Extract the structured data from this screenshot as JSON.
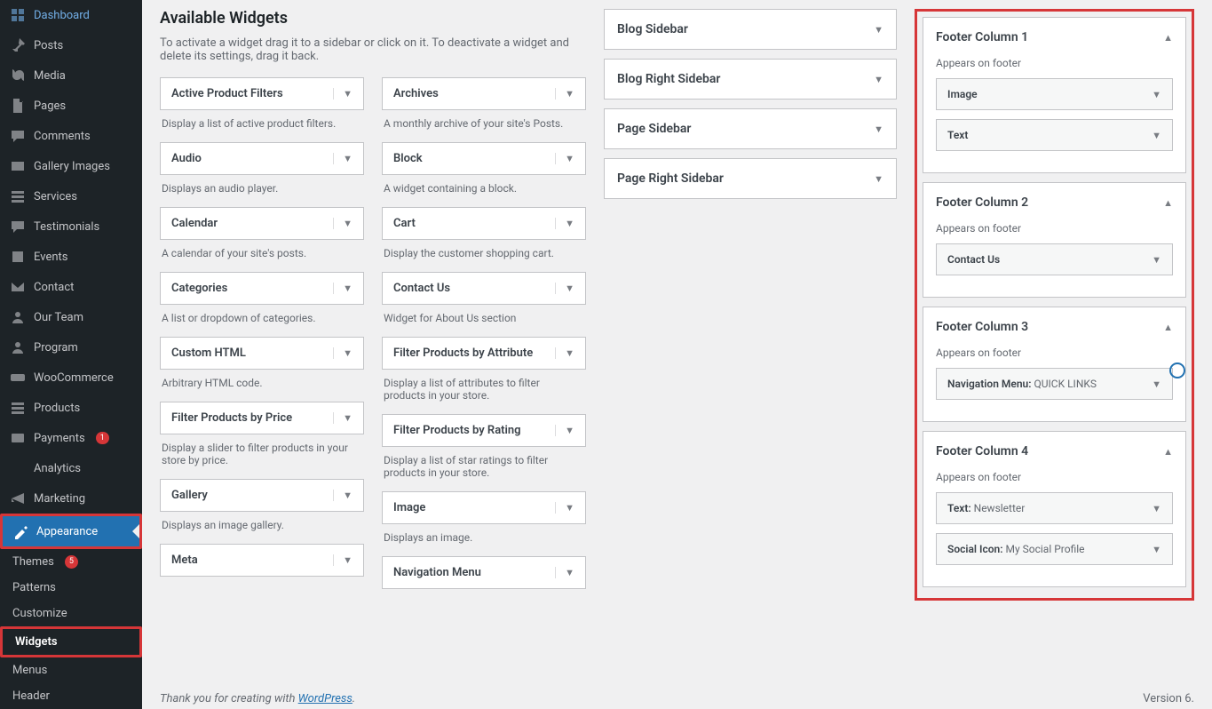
{
  "sidebar": {
    "items": [
      {
        "icon": "dashboard",
        "label": "Dashboard"
      },
      {
        "icon": "pin",
        "label": "Posts"
      },
      {
        "icon": "media",
        "label": "Media"
      },
      {
        "icon": "page",
        "label": "Pages"
      },
      {
        "icon": "comment",
        "label": "Comments"
      },
      {
        "icon": "gallery",
        "label": "Gallery Images"
      },
      {
        "icon": "services",
        "label": "Services"
      },
      {
        "icon": "testimonial",
        "label": "Testimonials"
      },
      {
        "icon": "calendar",
        "label": "Events"
      },
      {
        "icon": "mail",
        "label": "Contact"
      },
      {
        "icon": "team",
        "label": "Our Team"
      },
      {
        "icon": "program",
        "label": "Program"
      },
      {
        "icon": "woo",
        "label": "WooCommerce"
      },
      {
        "icon": "products",
        "label": "Products"
      },
      {
        "icon": "payments",
        "label": "Payments",
        "badge": "1"
      },
      {
        "icon": "analytics",
        "label": "Analytics"
      },
      {
        "icon": "marketing",
        "label": "Marketing"
      },
      {
        "icon": "appearance",
        "label": "Appearance",
        "active": true
      }
    ],
    "submenu": [
      {
        "label": "Themes",
        "badge": "5"
      },
      {
        "label": "Patterns"
      },
      {
        "label": "Customize"
      },
      {
        "label": "Widgets",
        "current": true
      },
      {
        "label": "Menus"
      },
      {
        "label": "Header"
      }
    ]
  },
  "available": {
    "title": "Available Widgets",
    "desc": "To activate a widget drag it to a sidebar or click on it. To deactivate a widget and delete its settings, drag it back.",
    "left": [
      {
        "name": "Active Product Filters",
        "desc": "Display a list of active product filters."
      },
      {
        "name": "Audio",
        "desc": "Displays an audio player."
      },
      {
        "name": "Calendar",
        "desc": "A calendar of your site's posts."
      },
      {
        "name": "Categories",
        "desc": "A list or dropdown of categories."
      },
      {
        "name": "Custom HTML",
        "desc": "Arbitrary HTML code."
      },
      {
        "name": "Filter Products by Price",
        "desc": "Display a slider to filter products in your store by price."
      },
      {
        "name": "Gallery",
        "desc": "Displays an image gallery."
      },
      {
        "name": "Meta",
        "desc": ""
      }
    ],
    "right": [
      {
        "name": "Archives",
        "desc": "A monthly archive of your site's Posts."
      },
      {
        "name": "Block",
        "desc": "A widget containing a block."
      },
      {
        "name": "Cart",
        "desc": "Display the customer shopping cart."
      },
      {
        "name": "Contact Us",
        "desc": "Widget for About Us section"
      },
      {
        "name": "Filter Products by Attribute",
        "desc": "Display a list of attributes to filter products in your store."
      },
      {
        "name": "Filter Products by Rating",
        "desc": "Display a list of star ratings to filter products in your store."
      },
      {
        "name": "Image",
        "desc": "Displays an image."
      },
      {
        "name": "Navigation Menu",
        "desc": ""
      }
    ]
  },
  "mid_areas": [
    {
      "title": "Blog Sidebar"
    },
    {
      "title": "Blog Right Sidebar"
    },
    {
      "title": "Page Sidebar"
    },
    {
      "title": "Page Right Sidebar"
    }
  ],
  "right_areas": [
    {
      "title": "Footer Column 1",
      "sub": "Appears on footer",
      "widgets": [
        {
          "label": "Image"
        },
        {
          "label": "Text"
        }
      ]
    },
    {
      "title": "Footer Column 2",
      "sub": "Appears on footer",
      "widgets": [
        {
          "label": "Contact Us"
        }
      ]
    },
    {
      "title": "Footer Column 3",
      "sub": "Appears on footer",
      "widgets": [
        {
          "label": "Navigation Menu:",
          "thin": " QUICK LINKS"
        }
      ]
    },
    {
      "title": "Footer Column 4",
      "sub": "Appears on footer",
      "widgets": [
        {
          "label": "Text:",
          "thin": " Newsletter"
        },
        {
          "label": "Social Icon:",
          "thin": " My Social Profile"
        }
      ]
    }
  ],
  "footer": {
    "credit_pre": "Thank you for creating with ",
    "credit_link": "WordPress",
    "credit_post": ".",
    "version": "Version 6."
  }
}
